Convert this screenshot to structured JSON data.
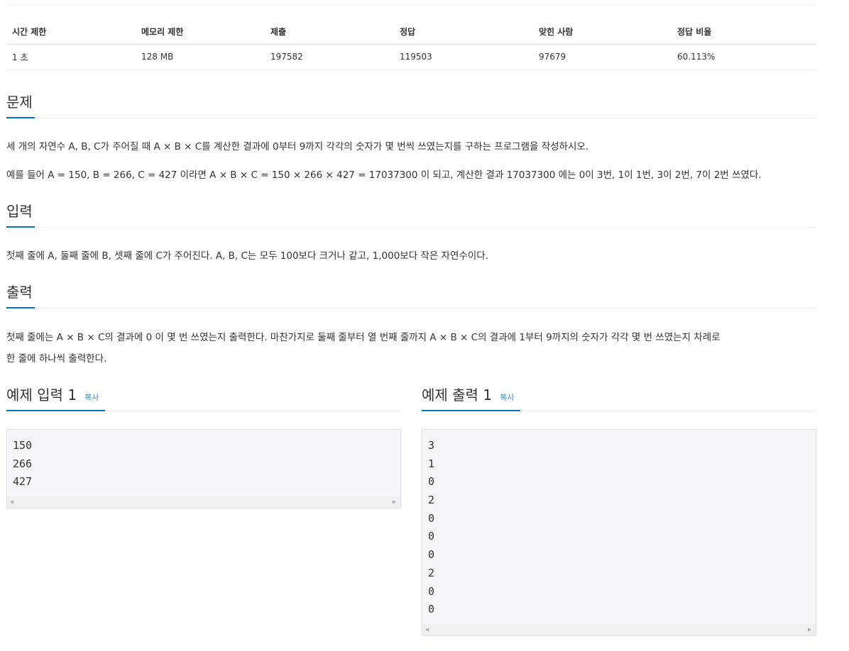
{
  "info_table": {
    "headers": [
      "시간 제한",
      "메모리 제한",
      "제출",
      "정답",
      "맞힌 사람",
      "정답 비율"
    ],
    "values": [
      "1 초",
      "128 MB",
      "197582",
      "119503",
      "97679",
      "60.113%"
    ]
  },
  "problem": {
    "title": "문제",
    "paragraphs": [
      "세 개의 자연수 A, B, C가 주어질 때 A × B × C를 계산한 결과에 0부터 9까지 각각의 숫자가 몇 번씩 쓰였는지를 구하는 프로그램을 작성하시오.",
      "예를 들어 A = 150, B = 266, C = 427 이라면 A × B × C = 150 × 266 × 427 = 17037300 이 되고, 계산한 결과 17037300 에는 0이 3번, 1이 1번, 3이 2번, 7이 2번 쓰였다."
    ]
  },
  "input": {
    "title": "입력",
    "text": "첫째 줄에 A, 둘째 줄에 B, 셋째 줄에 C가 주어진다. A, B, C는 모두 100보다 크거나 같고, 1,000보다 작은 자연수이다."
  },
  "output": {
    "title": "출력",
    "line1": "첫째 줄에는 A × B × C의 결과에 0 이 몇 번 쓰였는지 출력한다. 마찬가지로 둘째 줄부터 열 번째 줄까지 A × B × C의 결과에 1부터 9까지의 숫자가 각각 몇 번 쓰였는지 차례로",
    "line2": "한 줄에 하나씩 출력한다."
  },
  "sample_input": {
    "title": "예제 입력 1",
    "copy_label": "복사",
    "lines": [
      "150",
      "266",
      "427"
    ]
  },
  "sample_output": {
    "title": "예제 출력 1",
    "copy_label": "복사",
    "lines": [
      "3",
      "1",
      "0",
      "2",
      "0",
      "0",
      "0",
      "2",
      "0",
      "0"
    ]
  },
  "icons": {
    "scroll_left": "scroll-left-arrow-icon",
    "scroll_right": "scroll-right-arrow-icon"
  },
  "colors": {
    "accent": "#0076c0",
    "link": "#428bca",
    "code_bg": "#f7f7f9"
  }
}
